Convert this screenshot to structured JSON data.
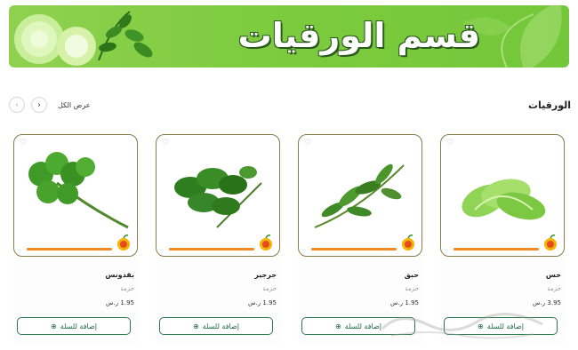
{
  "banner": {
    "title": "قسم الورقيات",
    "veg_icon": "lettuce-and-herbs-image",
    "leaf_icon": "leaf-decoration"
  },
  "section": {
    "title": "الورقيات",
    "view_all": "عرض الكل",
    "prev_icon": "chevron-left-icon",
    "next_icon": "chevron-right-icon"
  },
  "colors": {
    "banner_green": "#7dcb3e",
    "button_green": "#1f6a3e",
    "progress_orange": "#f08a24",
    "card_border": "#8a7a4a"
  },
  "products": [
    {
      "name": "خس",
      "unit": "حزمة",
      "price": "3.95",
      "currency": "ر.س",
      "button": "إضافة للسلة",
      "image": "lettuce"
    },
    {
      "name": "حبق",
      "unit": "حزمة",
      "price": "1.95",
      "currency": "ر.س",
      "button": "إضافة للسلة",
      "image": "basil"
    },
    {
      "name": "جرجير",
      "unit": "حزمة",
      "price": "1.95",
      "currency": "ر.س",
      "button": "إضافة للسلة",
      "image": "arugula"
    },
    {
      "name": "بقدونس",
      "unit": "حزمة",
      "price": "1.95",
      "currency": "ر.س",
      "button": "إضافة للسلة",
      "image": "parsley"
    }
  ]
}
